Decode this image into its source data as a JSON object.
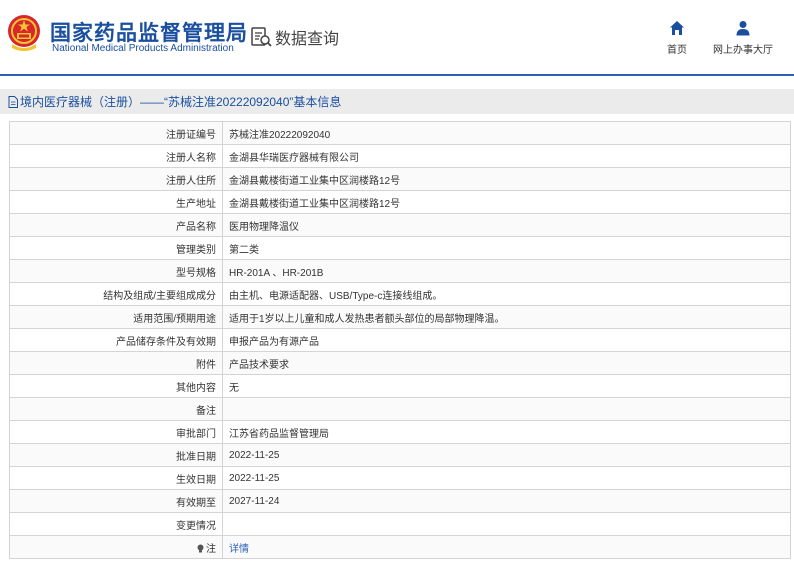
{
  "header": {
    "logo_cn": "国家药品监督管理局",
    "logo_en": "National Medical Products Administration",
    "query_label": "数据查询",
    "nav_home": "首页",
    "nav_office": "网上办事大厅",
    "accent_color": "#1a4fa0"
  },
  "title_bar": {
    "text": "境内医疗器械（注册）——“苏械注准20222092040”基本信息"
  },
  "table": {
    "rows": [
      {
        "label": "注册证编号",
        "value": "苏械注准20222092040"
      },
      {
        "label": "注册人名称",
        "value": "金湖县华瑞医疗器械有限公司"
      },
      {
        "label": "注册人住所",
        "value": "金湖县戴楼街道工业集中区润楼路12号"
      },
      {
        "label": "生产地址",
        "value": "金湖县戴楼街道工业集中区润楼路12号"
      },
      {
        "label": "产品名称",
        "value": "医用物理降温仪"
      },
      {
        "label": "管理类别",
        "value": "第二类"
      },
      {
        "label": "型号规格",
        "value": "HR-201A 、HR-201B"
      },
      {
        "label": "结构及组成/主要组成成分",
        "value": "由主机、电源适配器、USB/Type-c连接线组成。"
      },
      {
        "label": "适用范围/预期用途",
        "value": "适用于1岁以上儿童和成人发热患者额头部位的局部物理降温。"
      },
      {
        "label": "产品储存条件及有效期",
        "value": "申报产品为有源产品"
      },
      {
        "label": "附件",
        "value": "产品技术要求"
      },
      {
        "label": "其他内容",
        "value": "无"
      },
      {
        "label": "备注",
        "value": ""
      },
      {
        "label": "审批部门",
        "value": "江苏省药品监督管理局"
      },
      {
        "label": "批准日期",
        "value": "2022-11-25"
      },
      {
        "label": "生效日期",
        "value": "2022-11-25"
      },
      {
        "label": "有效期至",
        "value": "2027-11-24"
      },
      {
        "label": "变更情况",
        "value": ""
      }
    ],
    "note_label": "注",
    "detail_link": "详情"
  }
}
